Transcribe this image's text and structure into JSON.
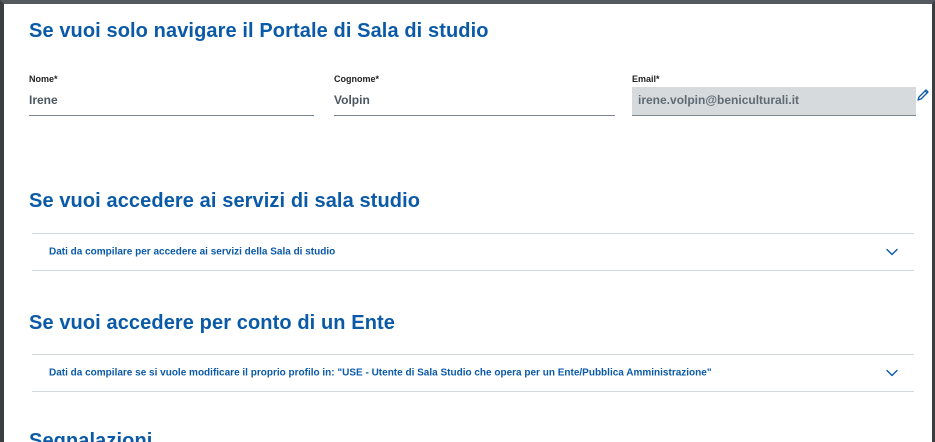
{
  "sections": {
    "navigate_title": "Se vuoi solo navigare il Portale di Sala di studio",
    "services_title": "Se vuoi accedere ai servizi di sala studio",
    "ente_title": "Se vuoi accedere per conto di un Ente",
    "reports_title": "Segnalazioni"
  },
  "form": {
    "nome": {
      "label": "Nome*",
      "value": "Irene"
    },
    "cognome": {
      "label": "Cognome*",
      "value": "Volpin"
    },
    "email": {
      "label": "Email*",
      "value": "irene.volpin@beniculturali.it"
    }
  },
  "accordions": {
    "services": {
      "label": "Dati da compilare per accedere ai servizi della Sala di studio"
    },
    "ente": {
      "label": "Dati da compilare se si vuole modificare il proprio profilo in: \"USE - Utente di Sala Studio che opera per un Ente/Pubblica Amministrazione\""
    }
  },
  "colors": {
    "accent": "#0a5aa8",
    "readonly_bg": "#d6dadd",
    "frame": "#3b3f42"
  },
  "icons": {
    "edit": "pencil-icon",
    "expand": "chevron-down-icon"
  }
}
